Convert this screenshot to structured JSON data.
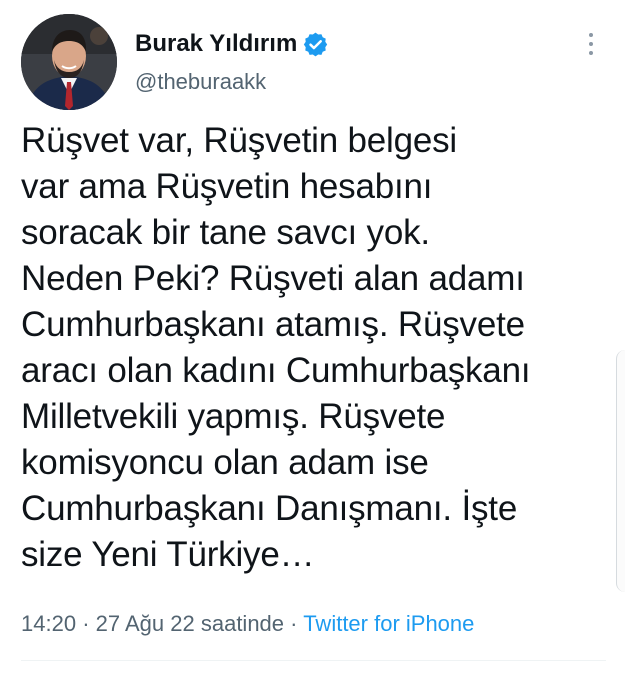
{
  "author": {
    "name": "Burak Yıldırım",
    "handle": "@theburaakk",
    "verified": true,
    "avatar_icon": "profile-photo",
    "verified_icon": "verified-badge-icon"
  },
  "more_icon": "more-vertical-icon",
  "tweet": {
    "lines": [
      "Rüşvet var, Rüşvetin belgesi",
      "var ama Rüşvetin hesabını",
      "soracak bir tane savcı yok.",
      "Neden Peki? Rüşveti alan adamı",
      "Cumhurbaşkanı atamış. Rüşvete",
      "aracı olan kadını Cumhurbaşkanı",
      "Milletvekili yapmış. Rüşvete",
      "komisyoncu olan adam ise",
      "Cumhurbaşkanı Danışmanı. İşte",
      "size Yeni Türkiye…"
    ]
  },
  "meta": {
    "time": "14:20",
    "separator": "·",
    "date": "27 Ağu 22 saatinde",
    "source": "Twitter for iPhone"
  },
  "colors": {
    "text": "#0f1419",
    "secondary": "#536471",
    "link": "#1d9bf0",
    "verified": "#1d9bf0"
  }
}
